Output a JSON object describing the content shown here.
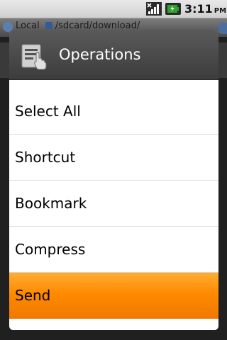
{
  "status_bar": {
    "time": "3:11",
    "ampm": "PM",
    "signal_icon": "signal-no-sim-icon",
    "battery_icon": "battery-charging-icon",
    "battery_color": "#2aa52a"
  },
  "background": {
    "path_label": "Local",
    "path": "/sdcard/download/"
  },
  "dialog": {
    "title": "Operations",
    "icon": "file-operations-icon",
    "items": [
      {
        "label": "Select All"
      },
      {
        "label": "Shortcut"
      },
      {
        "label": "Bookmark"
      },
      {
        "label": "Compress"
      },
      {
        "label": "Send",
        "selected": true
      }
    ],
    "selected_color": "#ff8a00"
  }
}
